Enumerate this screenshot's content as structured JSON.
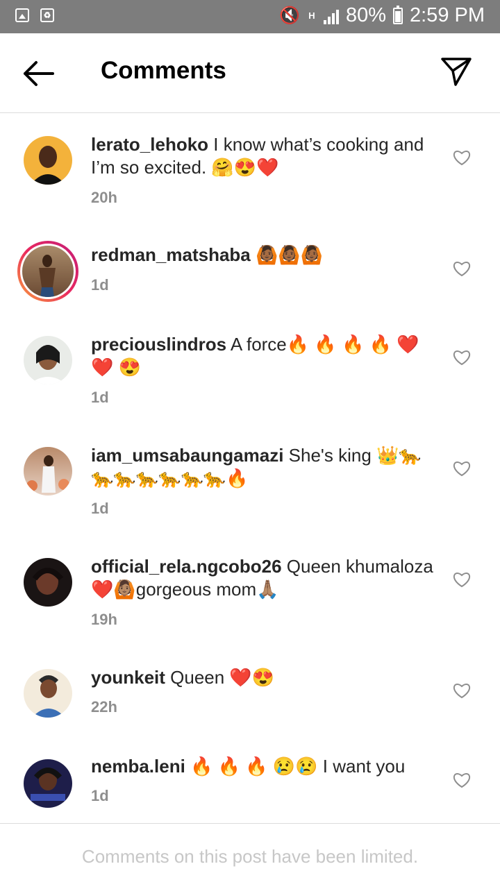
{
  "status_bar": {
    "battery": "80%",
    "time": "2:59 PM",
    "network": "H"
  },
  "header": {
    "title": "Comments"
  },
  "comments": [
    {
      "username": "lerato_lehoko",
      "text": " I know what’s cooking and I’m so excited. 🤗😍❤️",
      "time": "20h"
    },
    {
      "username": "redman_matshaba",
      "text": " 🙆🏾🙆🏾🙆🏾",
      "time": "1d"
    },
    {
      "username": "preciouslindros",
      "text": " A force🔥 🔥 🔥 🔥 ❤️❤️ 😍",
      "time": "1d"
    },
    {
      "username": "iam_umsabaungamazi",
      "text": " She's king 👑🐆🐆🐆🐆🐆🐆🐆🔥",
      "time": "1d"
    },
    {
      "username": "official_rela.ngcobo26",
      "text": " Queen khumaloza❤️🙆🏽gorgeous mom🙏🏽",
      "time": "19h"
    },
    {
      "username": "younkeit",
      "text": " Queen ❤️😍",
      "time": "22h"
    },
    {
      "username": "nemba.leni",
      "text": " 🔥 🔥 🔥 😢😢 I want you",
      "time": "1d"
    }
  ],
  "footer": {
    "text": "Comments on this post have been limited."
  },
  "colors": {
    "muted": "#8e8e8e",
    "divider": "#dbdbdb",
    "status_bar": "#7d7d7d",
    "story_ring_start": "#f9a13c",
    "story_ring_end": "#c21e78"
  }
}
